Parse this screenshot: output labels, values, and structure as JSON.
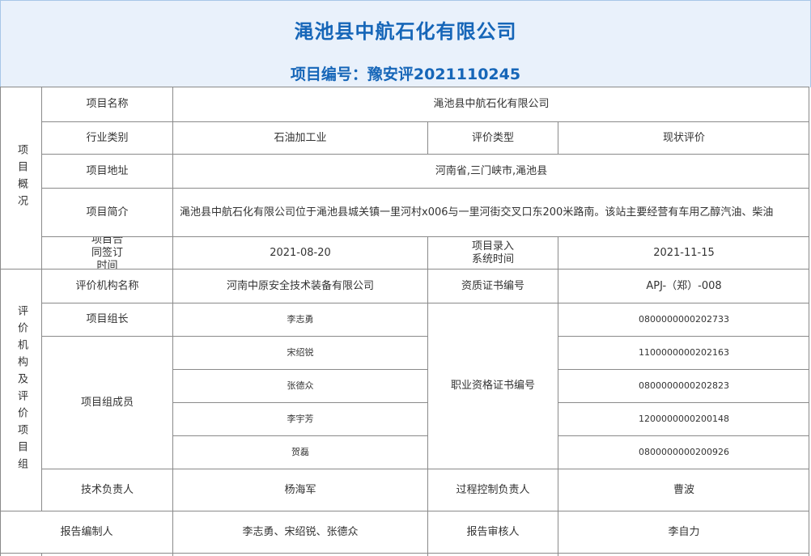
{
  "header": {
    "title": "渑池县中航石化有限公司",
    "project_code_label": "项目编号：豫安评2021110245"
  },
  "overview": {
    "section_label": "项目概况",
    "project_name_label": "项目名称",
    "project_name": "渑池县中航石化有限公司",
    "industry_label": "行业类别",
    "industry": "石油加工业",
    "eval_type_label": "评价类型",
    "eval_type": "现状评价",
    "address_label": "项目地址",
    "address": "河南省,三门峡市,渑池县",
    "intro_label": "项目简介",
    "intro": "渑池县中航石化有限公司位于渑池县城关镇一里河村x006与一里河街交叉口东200米路南。该站主要经营有车用乙醇汽油、柴油",
    "contract_label": "项目合同签订时间",
    "contract_date": "2021-08-20",
    "entry_label": "项目录入系统时间",
    "entry_date": "2021-11-15"
  },
  "org": {
    "section_label": "评价机构及评价项目组",
    "org_name_label": "评价机构名称",
    "org_name": "河南中原安全技术装备有限公司",
    "cert_no_label": "资质证书编号",
    "cert_no": "APJ-（郑）-008",
    "leader_label": "项目组长",
    "leader": "李志勇",
    "leader_cert": "0800000000202733",
    "members_label": "项目组成员",
    "qual_cert_label": "职业资格证书编号",
    "members": [
      {
        "name": "宋绍锐",
        "cert": "1100000000202163"
      },
      {
        "name": "张德众",
        "cert": "0800000000202823"
      },
      {
        "name": "李宇芳",
        "cert": "1200000000200148"
      },
      {
        "name": "贺磊",
        "cert": "0800000000200926"
      }
    ],
    "tech_lead_label": "技术负责人",
    "tech_lead": "杨海军",
    "process_lead_label": "过程控制负责人",
    "process_lead": "曹波"
  },
  "report": {
    "author_label": "报告编制人",
    "authors": "李志勇、宋绍锐、张德众",
    "reviewer_label": "报告审核人",
    "reviewer": "李自力"
  }
}
